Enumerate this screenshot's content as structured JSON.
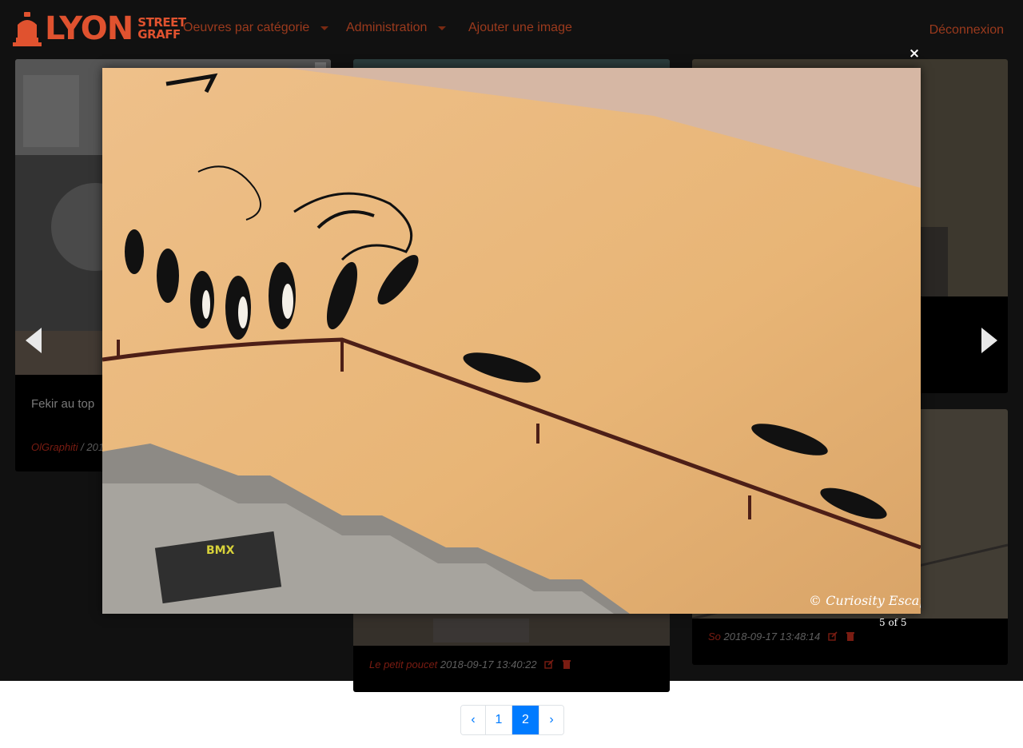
{
  "navbar": {
    "brand_word": "LYON",
    "brand_sub_1": "STREET",
    "brand_sub_2": "GRAFF",
    "menu": [
      {
        "label": "Oeuvres par catégorie",
        "has_caret": true
      },
      {
        "label": "Administration",
        "has_caret": true
      },
      {
        "label": "Ajouter une image",
        "has_caret": false
      }
    ],
    "logout_label": "Déconnexion"
  },
  "cards": [
    {
      "title": "Fekir au top",
      "author": "OlGraphiti",
      "date": "201"
    },
    {
      "title": "",
      "author": "Le petit poucet",
      "date": "2018-09-17 13:40:22"
    },
    {
      "title": "",
      "author": "So",
      "date": "2018-09-17 13:48:14"
    }
  ],
  "lightbox": {
    "close_symbol": "×",
    "counter": "5 of 5",
    "watermark": "© Curiosity Escapes"
  },
  "pagination": {
    "prev": "‹",
    "pages": [
      "1",
      "2"
    ],
    "active_page": "2",
    "next": "›"
  },
  "colors": {
    "brand": "#e0522f",
    "nav_link": "#9b3a1d",
    "accent": "#007bff"
  }
}
